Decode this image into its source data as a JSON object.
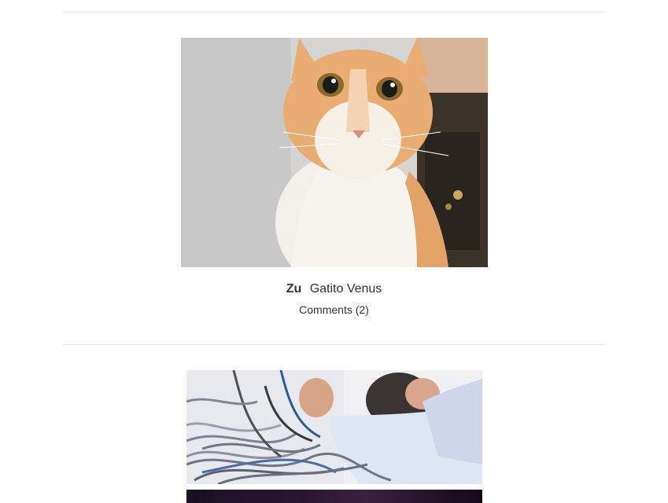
{
  "posts": [
    {
      "image_alt": "Gatito Venus",
      "author": "Zu",
      "title": "Gatito Venus",
      "comments_label": "Comments (2)"
    },
    {
      "image_alt": "Cables"
    }
  ]
}
